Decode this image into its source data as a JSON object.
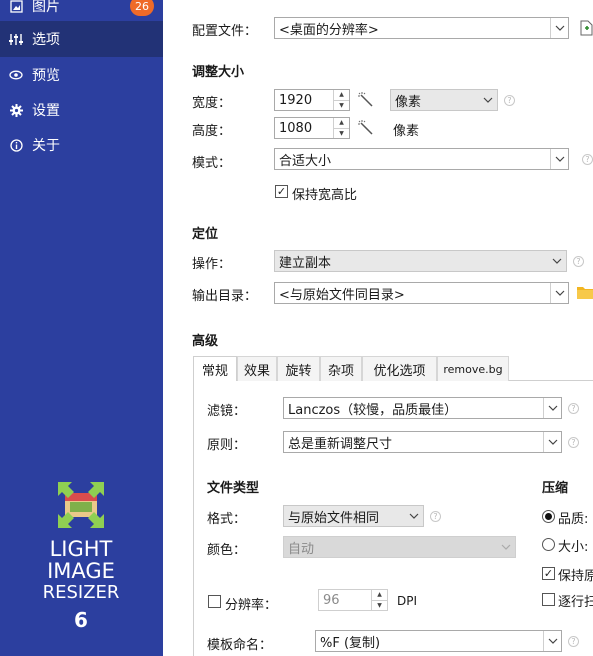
{
  "sidebar": {
    "items": [
      {
        "icon": "image-icon",
        "label": "图片",
        "badge": "26"
      },
      {
        "icon": "sliders-icon",
        "label": "选项"
      },
      {
        "icon": "eye-icon",
        "label": "预览"
      },
      {
        "icon": "gear-icon",
        "label": "设置"
      },
      {
        "icon": "info-icon",
        "label": "关于"
      }
    ],
    "active_index": 1,
    "logo": {
      "line1": "LIGHT",
      "line2": "IMAGE",
      "line3": "RESIZER",
      "version": "6"
    },
    "colors": {
      "background": "#2c3f9f",
      "active": "#223276",
      "badge": "#ef6a28"
    }
  },
  "profile": {
    "label": "配置文件：",
    "value": "<桌面的分辨率>"
  },
  "resize": {
    "title": "调整大小",
    "width": {
      "label": "宽度：",
      "value": "1920",
      "unit": "像素"
    },
    "height": {
      "label": "高度：",
      "value": "1080",
      "unit": "像素"
    },
    "mode": {
      "label": "模式：",
      "value": "合适大小"
    },
    "keep_ratio": {
      "label": "保持宽高比",
      "checked": true
    }
  },
  "position": {
    "title": "定位",
    "action": {
      "label": "操作：",
      "value": "建立副本"
    },
    "output": {
      "label": "输出目录：",
      "value": "<与原始文件同目录>"
    }
  },
  "advanced": {
    "title": "高级",
    "tabs": [
      "常规",
      "效果",
      "旋转",
      "杂项",
      "优化选项",
      "remove.bg"
    ],
    "active_tab": 0,
    "filter": {
      "label": "滤镜：",
      "value": "Lanczos（较慢，品质最佳）"
    },
    "rule": {
      "label": "原则：",
      "value": "总是重新调整尺寸"
    },
    "filetype": {
      "title": "文件类型",
      "format": {
        "label": "格式：",
        "value": "与原始文件相同"
      },
      "color": {
        "label": "颜色：",
        "value": "自动"
      }
    },
    "compression": {
      "title": "压缩",
      "quality": {
        "label": "品质:",
        "selected": true
      },
      "size": {
        "label": "大小:",
        "selected": false
      },
      "keep": {
        "label": "保持原",
        "checked": true
      },
      "progressive": {
        "label": "逐行扫",
        "checked": false
      }
    },
    "resolution": {
      "label": "分辨率：",
      "checked": false,
      "value": "96",
      "unit": "DPI"
    },
    "template": {
      "label": "模板命名：",
      "value": "%F (复制)"
    }
  }
}
